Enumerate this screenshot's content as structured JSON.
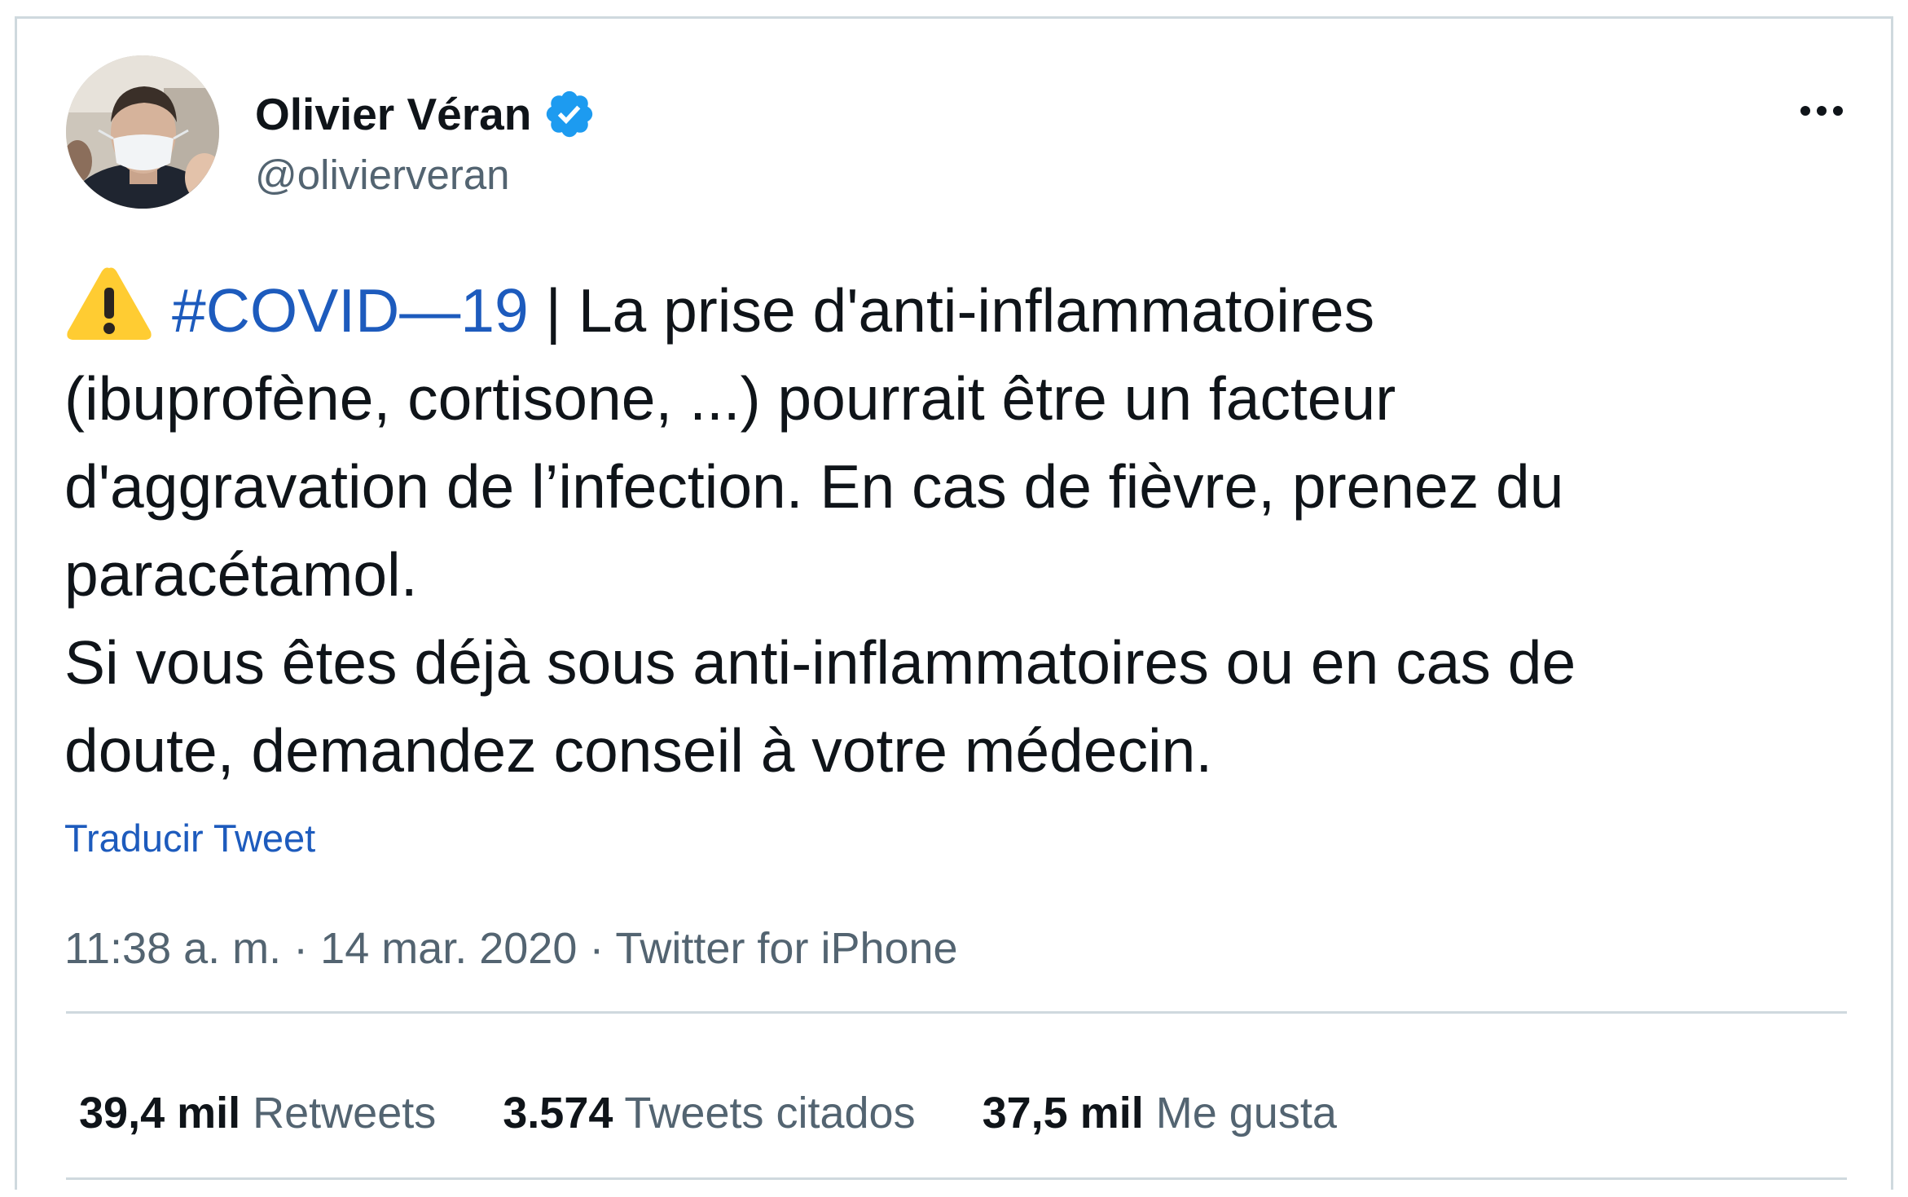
{
  "author": {
    "display_name": "Olivier Véran",
    "handle": "@olivierveran",
    "verified_icon": "verified-badge-icon",
    "avatar_icon": "profile-photo"
  },
  "more_icon": "more-horizontal-icon",
  "tweet": {
    "warning_icon": "warning-sign-emoji",
    "hashtag": "#COVID—19",
    "line1_rest": " | La prise d'anti-inflammatoires",
    "line2": "(ibuprofène, cortisone, ...) pourrait être un facteur",
    "line3": "d'aggravation de l’infection. En cas de fièvre, prenez du",
    "line4": "paracétamol.",
    "line5": "Si vous êtes déjà sous anti-inflammatoires ou en cas de",
    "line6": "doute, demandez conseil à votre médecin."
  },
  "translate_label": "Traducir Tweet",
  "meta": {
    "time": "11:38 a. m.",
    "separator": " · ",
    "date": "14 mar. 2020",
    "source": "Twitter for iPhone"
  },
  "stats": [
    {
      "count": "39,4 mil",
      "label": "Retweets"
    },
    {
      "count": "3.574",
      "label": "Tweets citados"
    },
    {
      "count": "37,5 mil",
      "label": "Me gusta"
    }
  ],
  "colors": {
    "link_blue": "#1d5bbd",
    "verified_blue": "#1d9bf0",
    "text_primary": "#0f1419",
    "text_secondary": "#536471",
    "border": "#cfd9de",
    "warning_yellow": "#ffcc32"
  }
}
